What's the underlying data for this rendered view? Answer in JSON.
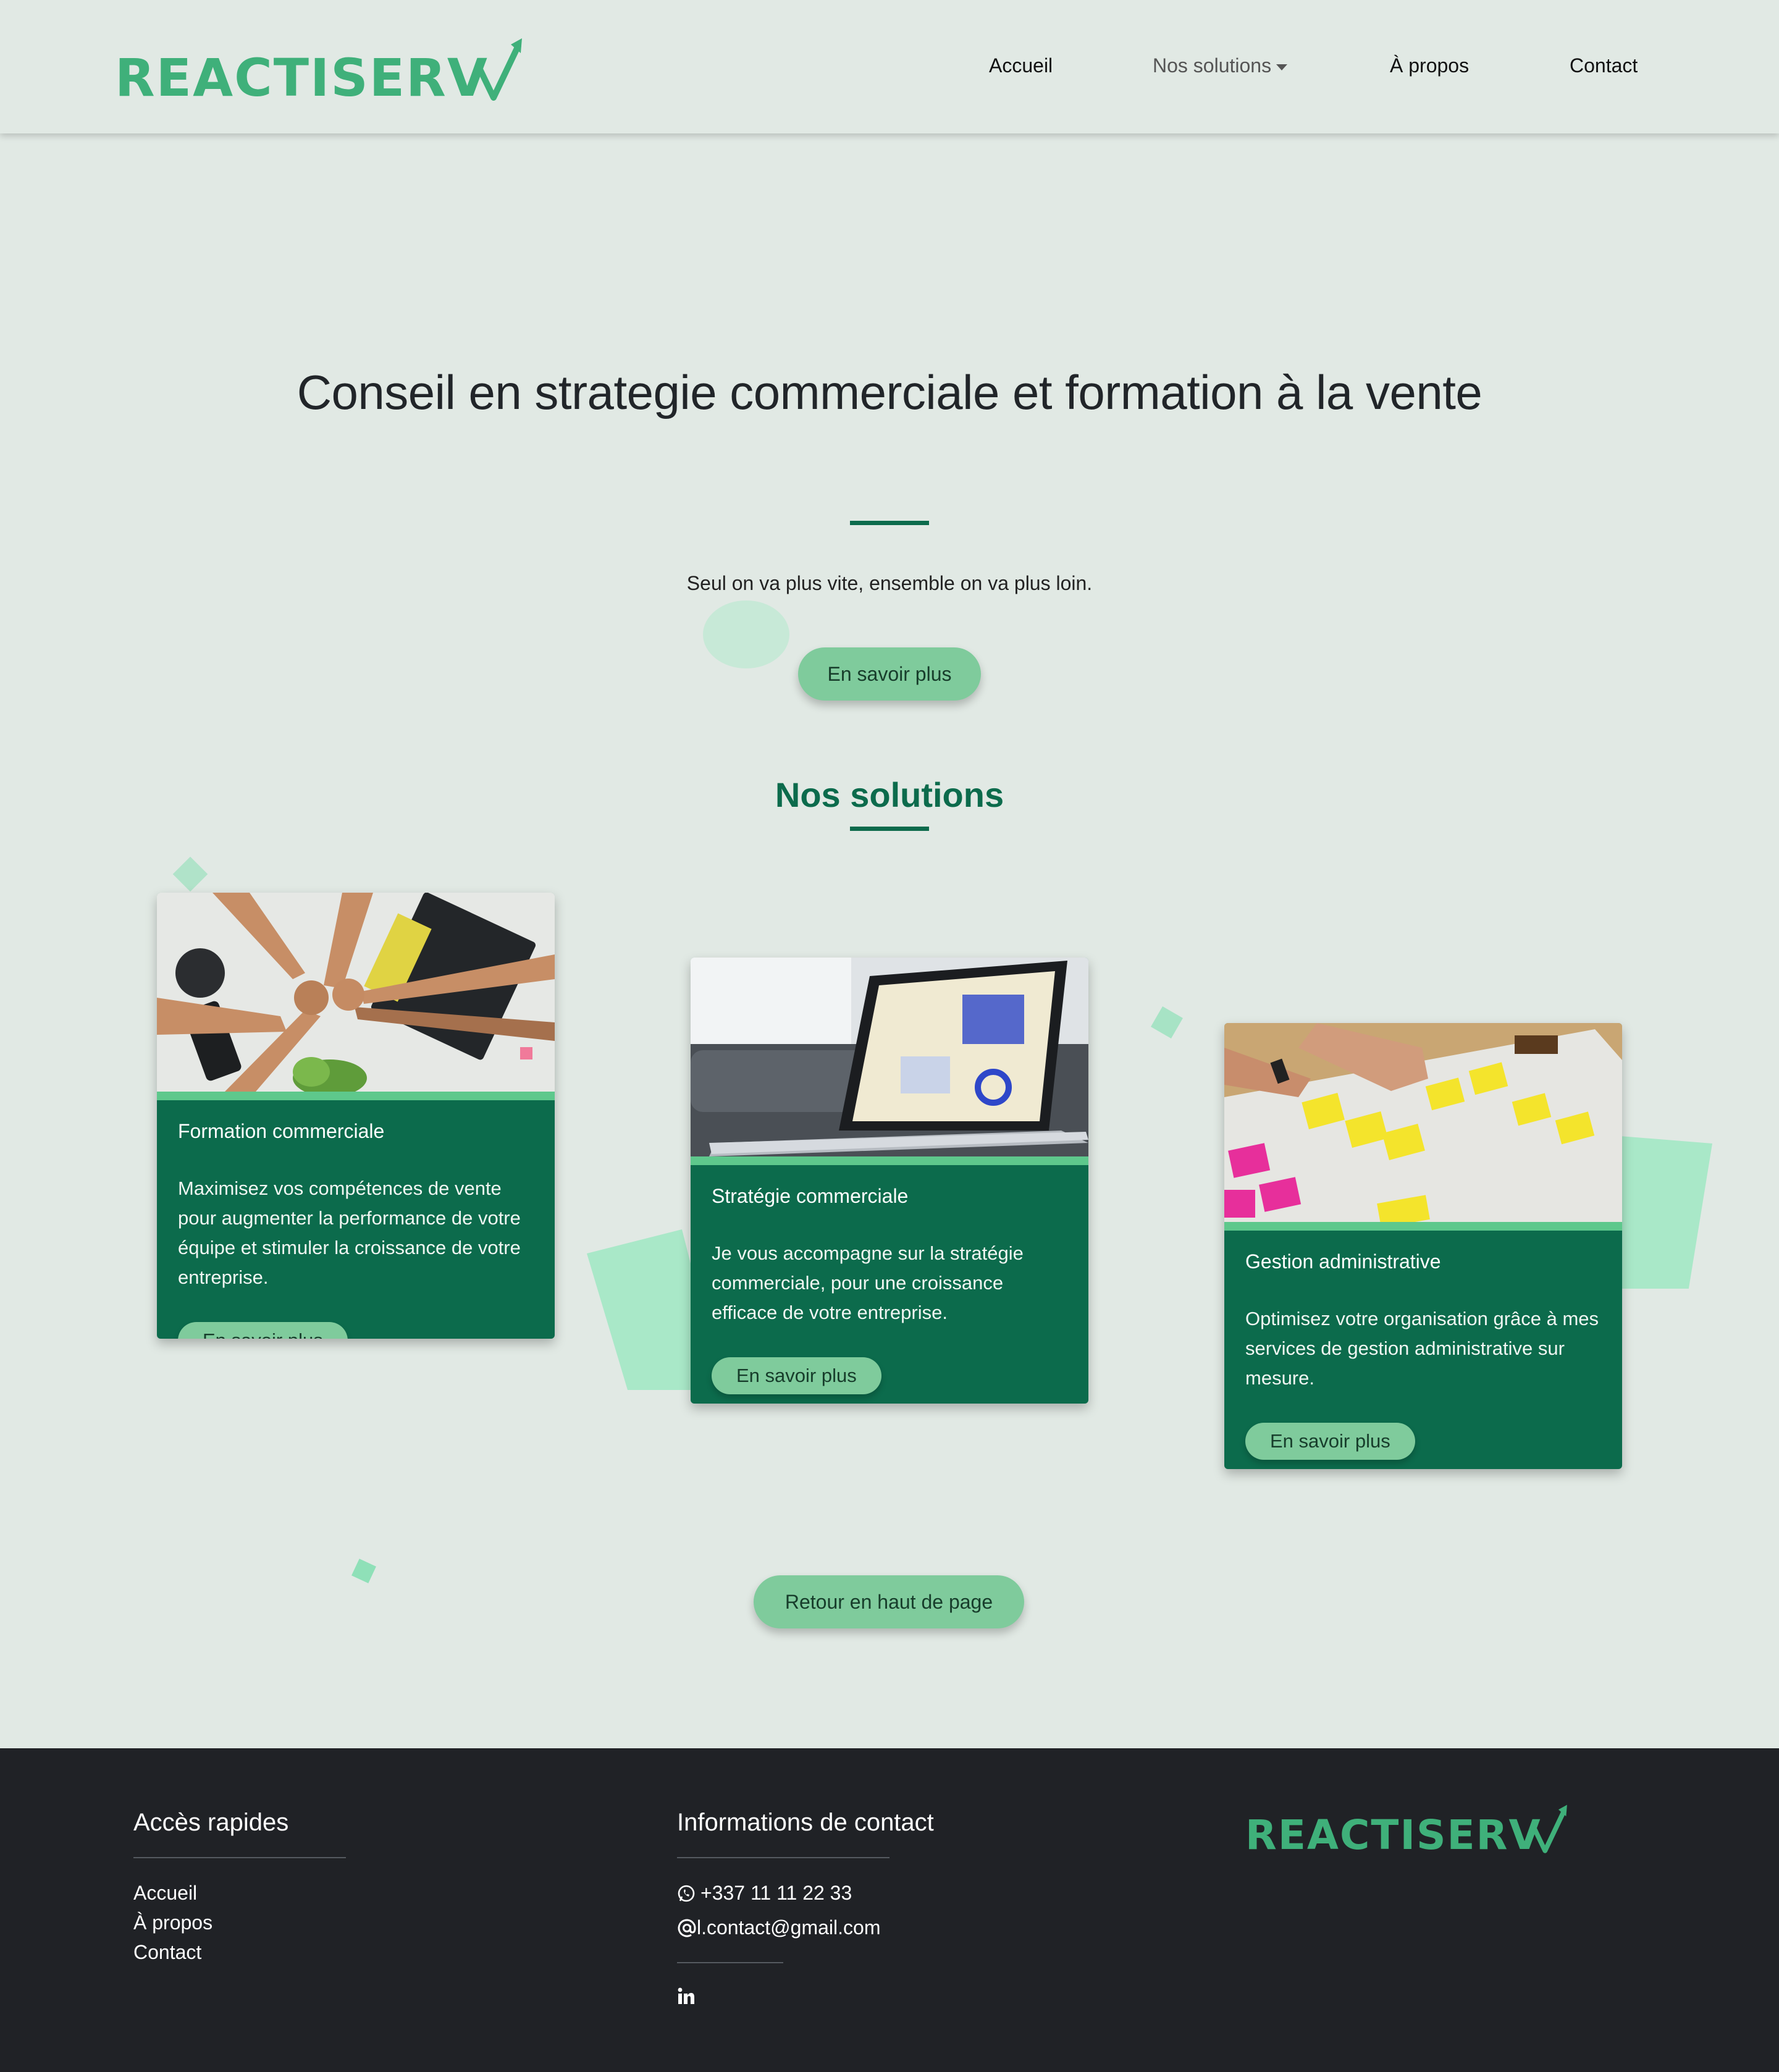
{
  "brand": {
    "logo_text": "REACTISERV",
    "accent_color": "#0c6b4c",
    "logo_color": "#3fb07a"
  },
  "nav": {
    "items": [
      {
        "label": "Accueil"
      },
      {
        "label": "Nos solutions"
      },
      {
        "label": "À propos"
      },
      {
        "label": "Contact"
      }
    ]
  },
  "hero": {
    "title": "Conseil en strategie commerciale et formation à la vente",
    "tagline": "Seul on va plus vite, ensemble on va plus loin.",
    "cta_label": "En savoir plus"
  },
  "solutions": {
    "title": "Nos solutions",
    "cards": [
      {
        "title": "Formation commerciale",
        "text": "Maximisez vos compétences de vente pour augmenter la performance de votre équipe et stimuler la croissance de votre entreprise.",
        "button": "En savoir plus",
        "image_icon": "team-hands-photo"
      },
      {
        "title": "Stratégie commerciale",
        "text": "Je vous accompagne sur la stratégie commerciale, pour une croissance efficace de votre entreprise.",
        "button": "En savoir plus",
        "image_icon": "laptop-dashboard-photo"
      },
      {
        "title": "Gestion administrative",
        "text": "Optimisez votre organisation grâce à mes services de gestion administrative sur mesure.",
        "button": "En savoir plus",
        "image_icon": "sticky-notes-photo"
      }
    ]
  },
  "back_to_top": {
    "label": "Retour en haut de page"
  },
  "footer": {
    "quick_access": {
      "title": "Accès rapides",
      "links": [
        "Accueil",
        "À propos",
        "Contact"
      ]
    },
    "contact": {
      "title": "Informations de contact",
      "phone": "+337 11 11 22 33",
      "email": "l.contact@gmail.com",
      "social_icon": "linkedin-icon",
      "phone_icon": "whatsapp-icon",
      "email_icon": "at-icon"
    },
    "logo_text": "REACTISERV"
  }
}
